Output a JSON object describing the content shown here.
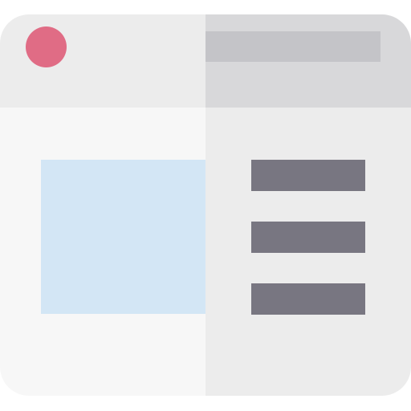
{
  "window": {
    "colors": {
      "titlebar_left": "#ececec",
      "titlebar_right": "#d8d8da",
      "body_left": "#f7f7f7",
      "body_right": "#ececec",
      "close_dot": "#e06c85",
      "address_bar": "#c4c4c8",
      "image_placeholder": "#d3e6f5",
      "text_lines": "#787681"
    },
    "icons": {
      "close": "close-dot-icon",
      "image": "image-placeholder-icon",
      "lines": "text-line-icon"
    }
  }
}
